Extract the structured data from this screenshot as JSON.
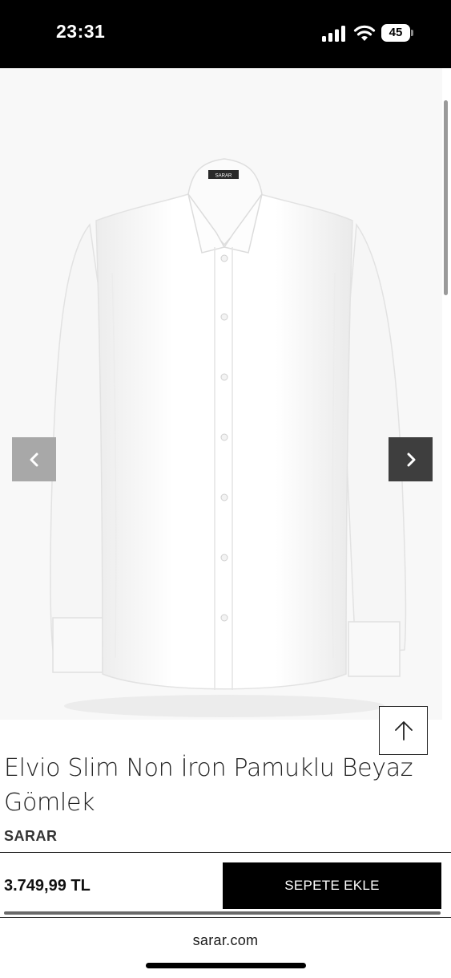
{
  "status_bar": {
    "time": "23:31",
    "battery": "45",
    "icons": [
      "signal-icon",
      "wifi-icon",
      "battery-icon"
    ]
  },
  "gallery": {
    "image": "white-dress-shirt",
    "shirt_label": "SARAR",
    "prev_icon": "chevron-left-icon",
    "next_icon": "chevron-right-icon"
  },
  "back_to_top_icon": "arrow-up-icon",
  "product": {
    "title": "Elvio Slim Non İron Pamuklu Beyaz Gömlek",
    "brand": "SARAR"
  },
  "cart": {
    "price": "3.749,99 TL",
    "add_button": "SEPETE EKLE"
  },
  "browser": {
    "url": "sarar.com"
  },
  "colors": {
    "status_bar_bg": "#000000",
    "button_bg": "#000000",
    "nav_next_bg": "#3e3e3e",
    "nav_prev_bg": "#a8a8a8"
  }
}
